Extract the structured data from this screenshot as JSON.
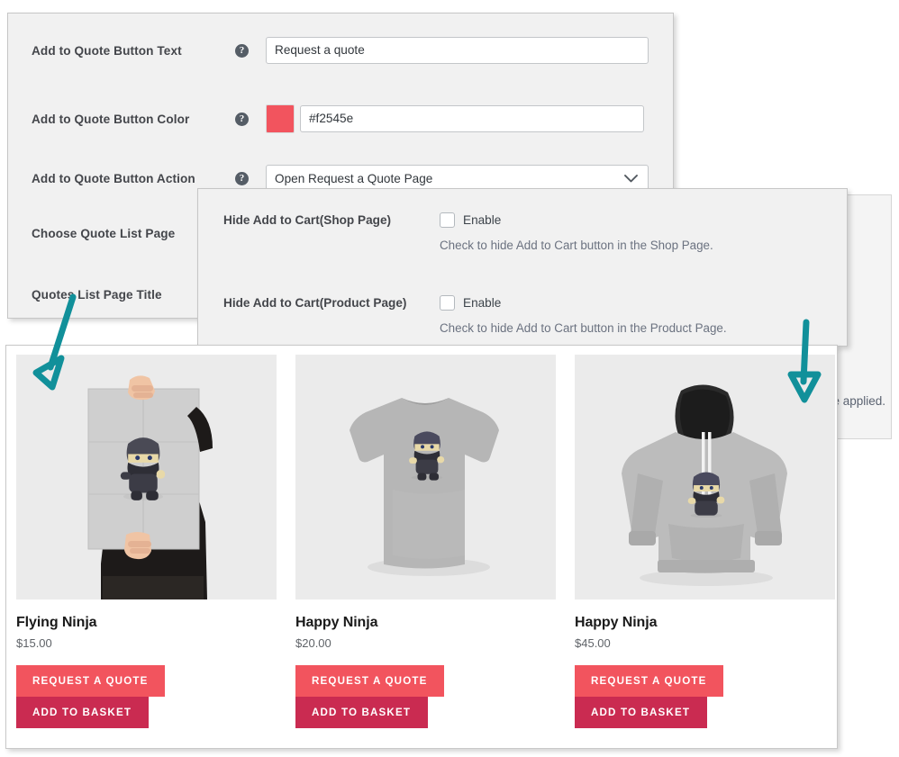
{
  "settings_panel": {
    "rows": [
      {
        "label": "Add to Quote Button Text",
        "help_icon": "question-mark-icon",
        "value": "Request a quote",
        "type": "text"
      },
      {
        "label": "Add to Quote Button Color",
        "help_icon": "question-mark-icon",
        "value": "#f2545e",
        "swatch_color": "#f2545e",
        "type": "color"
      },
      {
        "label": "Add to Quote Button Action",
        "help_icon": "question-mark-icon",
        "value": "Open Request a Quote Page",
        "type": "select"
      },
      {
        "label": "Choose Quote List Page",
        "type": "label-only"
      },
      {
        "label": "Quotes List Page Title",
        "type": "label-only"
      }
    ]
  },
  "hide_panel": {
    "rows": [
      {
        "label": "Hide Add to Cart(Shop Page)",
        "checkbox_label": "Enable",
        "checked": false,
        "help_text": "Check to hide Add to Cart button in the Shop Page."
      },
      {
        "label": "Hide Add to Cart(Product Page)",
        "checkbox_label": "Enable",
        "checked": false,
        "help_text": "Check to hide Add to Cart button in the Product Page."
      }
    ]
  },
  "background_panel": {
    "visible_text_fragment": "e applied."
  },
  "shop_panel": {
    "products": [
      {
        "name": "Flying Ninja",
        "price": "$15.00",
        "image": "poster-held-by-person-with-ninja-print",
        "quote_button": "REQUEST A QUOTE",
        "cart_button": "ADD TO BASKET"
      },
      {
        "name": "Happy Ninja",
        "price": "$20.00",
        "image": "grey-tshirt-with-ninja-print",
        "quote_button": "REQUEST A QUOTE",
        "cart_button": "ADD TO BASKET"
      },
      {
        "name": "Happy Ninja",
        "price": "$45.00",
        "image": "grey-hoodie-with-ninja-print",
        "quote_button": "REQUEST A QUOTE",
        "cart_button": "ADD TO BASKET"
      }
    ]
  },
  "annotations": {
    "arrows": [
      {
        "name": "arrow-pointing-to-quote-button",
        "direction": "down-left",
        "color": "#11909a"
      },
      {
        "name": "arrow-pointing-to-product-card",
        "direction": "down",
        "color": "#11909a"
      }
    ]
  },
  "colors": {
    "accent_red": "#f2545e",
    "cart_red": "#ca2b51",
    "arrow_teal": "#11909a",
    "panel_bg": "#f1f1f1"
  }
}
